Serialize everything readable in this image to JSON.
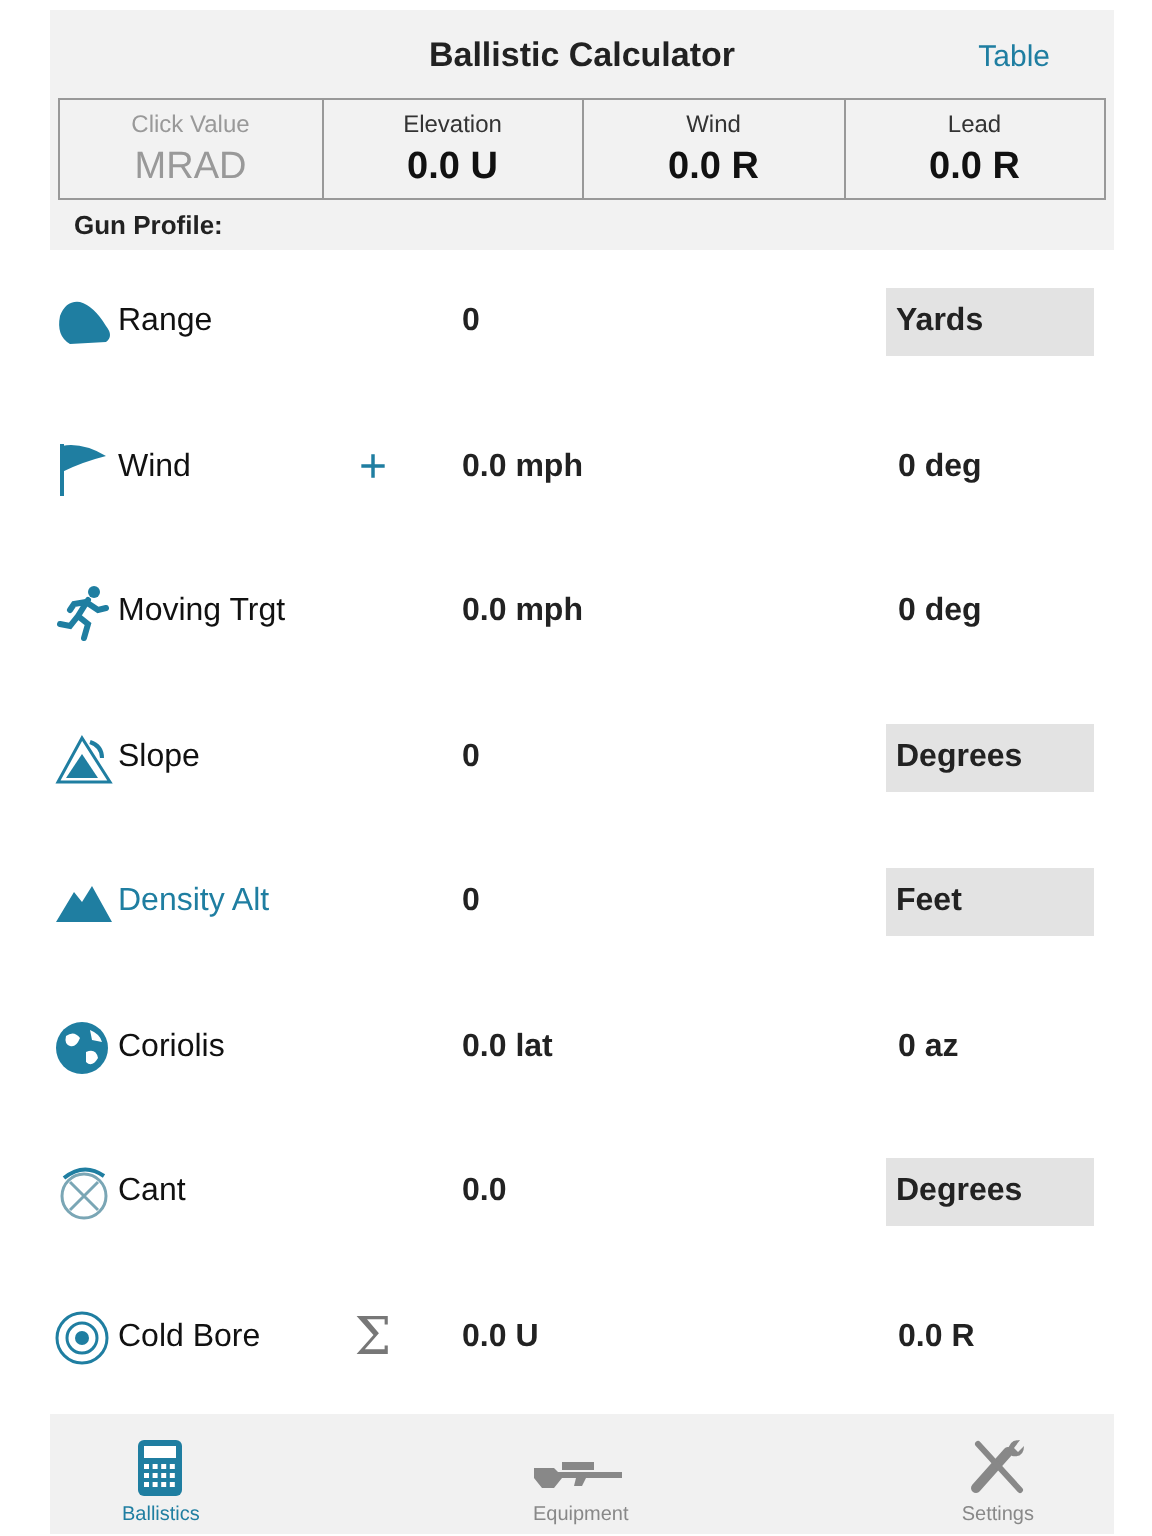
{
  "header": {
    "title": "Ballistic Calculator",
    "link": "Table"
  },
  "readouts": [
    {
      "label": "Click Value",
      "value": "MRAD",
      "disabled": true
    },
    {
      "label": "Elevation",
      "value": "0.0 U",
      "disabled": false
    },
    {
      "label": "Wind",
      "value": "0.0 R",
      "disabled": false
    },
    {
      "label": "Lead",
      "value": "0.0 R",
      "disabled": false
    }
  ],
  "section_label": "Gun Profile:",
  "rows": [
    {
      "label": "Range",
      "selected": false,
      "value": "0",
      "unit": {
        "kind": "dropdown",
        "text": "Yards"
      }
    },
    {
      "label": "Wind",
      "selected": false,
      "action": "+",
      "value": "0.0 mph",
      "unit": {
        "kind": "text",
        "text": "0 deg"
      }
    },
    {
      "label": "Moving Trgt",
      "selected": false,
      "value": "0.0 mph",
      "unit": {
        "kind": "text",
        "text": "0 deg"
      }
    },
    {
      "label": "Slope",
      "selected": false,
      "value": "0",
      "unit": {
        "kind": "dropdown",
        "text": "Degrees"
      }
    },
    {
      "label": "Density Alt",
      "selected": true,
      "value": "0",
      "unit": {
        "kind": "dropdown",
        "text": "Feet"
      }
    },
    {
      "label": "Coriolis",
      "selected": false,
      "value": "0.0 lat",
      "unit": {
        "kind": "text",
        "text": "0 az"
      }
    },
    {
      "label": "Cant",
      "selected": false,
      "value": "0.0",
      "unit": {
        "kind": "dropdown",
        "text": "Degrees"
      }
    },
    {
      "label": "Cold Bore",
      "selected": false,
      "action": "Σ",
      "value": "0.0 U",
      "unit": {
        "kind": "text",
        "text": "0.0 R"
      }
    }
  ],
  "tabs": [
    {
      "label": "Ballistics",
      "selected": true
    },
    {
      "label": "Equipment",
      "selected": false
    },
    {
      "label": "Settings",
      "selected": false
    }
  ]
}
